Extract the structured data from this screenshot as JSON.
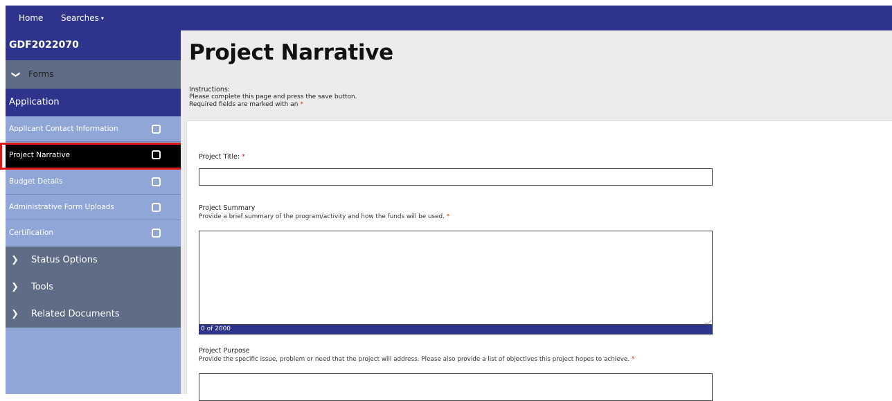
{
  "topnav": {
    "home": "Home",
    "searches": "Searches",
    "searches_caret": "▾"
  },
  "sidebar": {
    "header": "GDF2022070",
    "forms": {
      "label": "Forms",
      "icon": "chevron-down-icon",
      "chevron": "❯"
    },
    "application": "Application",
    "items": [
      {
        "label": "Applicant Contact Information",
        "active": false
      },
      {
        "label": "Project Narrative",
        "active": true
      },
      {
        "label": "Budget Details",
        "active": false
      },
      {
        "label": "Administrative Form Uploads",
        "active": false
      },
      {
        "label": "Certification",
        "active": false
      }
    ],
    "sections": [
      {
        "label": "Status Options",
        "chevron": "❯"
      },
      {
        "label": "Tools",
        "chevron": "❯"
      },
      {
        "label": "Related Documents",
        "chevron": "❯"
      }
    ]
  },
  "main": {
    "title": "Project Narrative",
    "instructions": {
      "heading": "Instructions:",
      "line1": "Please complete this page and press the save button.",
      "line2": "Required fields are marked with an",
      "required_mark": "*"
    },
    "fields": {
      "project_title": {
        "label": "Project Title:",
        "required_mark": "*",
        "value": ""
      },
      "project_summary": {
        "label": "Project Summary",
        "help": "Provide a brief summary of the program/activity and how the funds will be used.",
        "required_mark": "*",
        "value": "",
        "counter": "0 of 2000"
      },
      "project_purpose": {
        "label": "Project Purpose",
        "help": "Provide the specific issue, problem or need that the project will address. Please also provide a list of objectives this project hopes to achieve.",
        "required_mark": "*",
        "value": ""
      }
    }
  },
  "colors": {
    "navy": "#2e348c",
    "sidebar_blue": "#8fa6d6",
    "slate": "#5f6c86",
    "required_red": "#e0241b",
    "highlight_red": "#e01818"
  }
}
